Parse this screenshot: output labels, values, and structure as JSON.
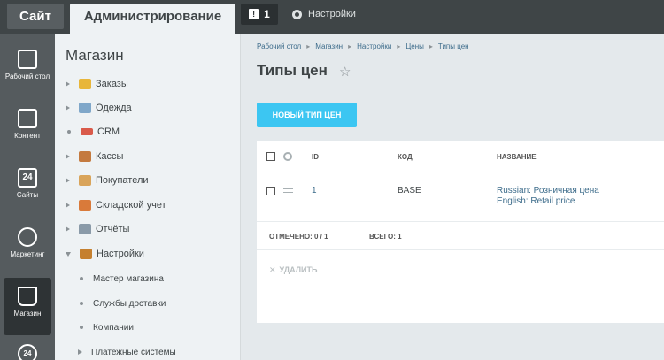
{
  "topbar": {
    "site_label": "Сайт",
    "admin_label": "Администрирование",
    "notifications_count": "1",
    "settings_label": "Настройки"
  },
  "rail": {
    "items": [
      {
        "label": "Рабочий стол",
        "icon": "home-icon"
      },
      {
        "label": "Контент",
        "icon": "document-icon"
      },
      {
        "label": "Сайты",
        "icon": "calendar-24-icon",
        "badge": "24"
      },
      {
        "label": "Маркетинг",
        "icon": "target-icon"
      },
      {
        "label": "Магазин",
        "icon": "basket-icon",
        "active": true
      },
      {
        "label": "",
        "icon": "clock-24-icon",
        "badge": "24"
      }
    ]
  },
  "menu": {
    "title": "Магазин",
    "items": [
      {
        "label": "Заказы",
        "icon_color": "#e8b63a"
      },
      {
        "label": "Одежда",
        "icon_color": "#7fa7c9"
      },
      {
        "label": "CRM",
        "icon_color": "#d95a4a"
      },
      {
        "label": "Кассы",
        "icon_color": "#c47a3f"
      },
      {
        "label": "Покупатели",
        "icon_color": "#d9a45a"
      },
      {
        "label": "Складской учет",
        "icon_color": "#d97a3a"
      },
      {
        "label": "Отчёты",
        "icon_color": "#8a9aa8"
      },
      {
        "label": "Настройки",
        "icon_color": "#c5802f"
      }
    ],
    "subitems": [
      {
        "label": "Мастер магазина"
      },
      {
        "label": "Службы доставки"
      },
      {
        "label": "Компании"
      },
      {
        "label": "Платежные системы"
      }
    ]
  },
  "breadcrumb": [
    "Рабочий стол",
    "Магазин",
    "Настройки",
    "Цены",
    "Типы цен"
  ],
  "page": {
    "title": "Типы цен",
    "add_button": "НОВЫЙ ТИП ЦЕН"
  },
  "grid": {
    "headers": {
      "id": "ID",
      "code": "КОД",
      "name": "НАЗВАНИЕ"
    },
    "rows": [
      {
        "id": "1",
        "code": "BASE",
        "name_ru": "Russian: Розничная цена",
        "name_en": "English: Retail price"
      }
    ],
    "selected_label": "ОТМЕЧЕНО:",
    "selected_value": "0 / 1",
    "total_label": "ВСЕГО:",
    "total_value": "1",
    "delete_label": "УДАЛИТЬ"
  },
  "colors": {
    "accent": "#3cc6f2",
    "topbar": "#3f4547",
    "rail": "#555b5e"
  }
}
